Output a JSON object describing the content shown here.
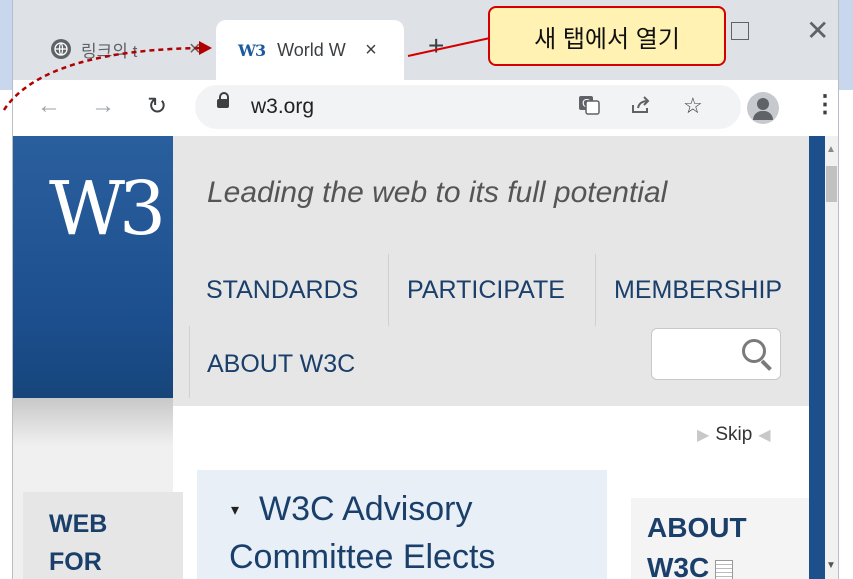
{
  "browser": {
    "inactive_tab_title": "링크의 t",
    "active_tab_title": "World W",
    "active_tab_favicon": "W3",
    "tab_close": "×",
    "new_tab": "+",
    "url": "w3.org"
  },
  "page": {
    "logo": "W3",
    "tagline": "Leading the web to its full potential",
    "nav": [
      "STANDARDS",
      "PARTICIPATE",
      "MEMBERSHIP",
      "ABOUT W3C"
    ],
    "skip": "Skip",
    "left_col": [
      "WEB",
      "FOR"
    ],
    "news_headline": [
      "W3C Advisory",
      "Committee Elects"
    ],
    "right_col": [
      "ABOUT",
      "W3C"
    ]
  },
  "annotation": {
    "callout_text": "새 탭에서 열기",
    "callout_fill": "#fff2b3",
    "callout_border": "#d40000"
  },
  "icons": [
    "globe-icon",
    "w3-favicon-icon",
    "close-icon",
    "plus-icon",
    "maximize-icon",
    "back-arrow-icon",
    "forward-arrow-icon",
    "reload-icon",
    "lock-icon",
    "translate-icon",
    "share-icon",
    "star-icon",
    "profile-icon",
    "menu-dots-icon",
    "search-icon",
    "document-icon"
  ]
}
